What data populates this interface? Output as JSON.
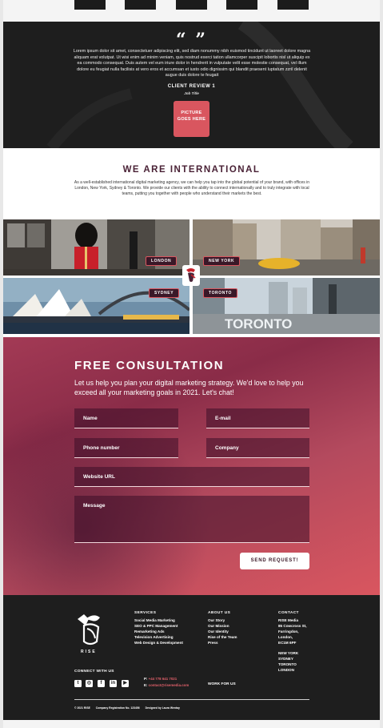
{
  "testimonial": {
    "quote_mark": "“ ”",
    "text": "Lorem ipsum dolor sit amet, consectetuer adipiscing elit, sed diam nonummy nibh euismod tincidunt ut laoreet dolore magna aliquam erat volutpat. Ut wisi enim ad minim veniam, quis nostrud exerci tation ullamcorper suscipit lobortis nisl ut aliquip ex ea commodo consequat. Duis autem vel eum iriure dolor in hendrerit in vulputate velit esse molestie consequat, vel illum dolore eu feugiat nulla facilisis at vero eros et accumsan et iusto odio dignissim qui blandit praesent luptatum zzril delenit augue duis dolore te feugait",
    "client_name": "CLIENT REVIEW 1",
    "client_title": "Job Title",
    "picture_button": "PICTURE GOES HERE"
  },
  "international": {
    "title": "WE ARE INTERNATIONAL",
    "text": "As a well-established international digital marketing agency, we can help you tap into the global potential of your brand, with offices in London, New York, Sydney & Toronto. We provide our clients with the ability to connect internationally and to truly integrate with local teams, putting you together with people who understand their markets the best."
  },
  "cities": [
    "LONDON",
    "NEW YORK",
    "SYDNEY",
    "TORONTO"
  ],
  "city_photo_text": {
    "toronto_sign": "TORONTO"
  },
  "consultation": {
    "title": "FREE CONSULTATION",
    "subtitle": "Let us help you plan your digital marketing strategy. We'd love to help you exceed all your marketing goals in 2021. Let's chat!",
    "fields": {
      "name": "Name",
      "email": "E-mail",
      "phone": "Phone number",
      "company": "Company",
      "website": "Website URL",
      "message": "Message"
    },
    "submit": "SEND REQUEST!"
  },
  "footer": {
    "brand": "RISE",
    "services": {
      "heading": "SERVICES",
      "items": [
        "Social Media Marketing",
        "SEO & PPC Management",
        "Remarketing Ads",
        "Television Advertising",
        "Web Design & Development"
      ]
    },
    "about": {
      "heading": "ABOUT US",
      "items": [
        "Our Story",
        "Our Mission",
        "Our Identity",
        "Rise of the Team",
        "Press"
      ]
    },
    "contact": {
      "heading": "CONTACT",
      "address": [
        "RISE Media",
        "85 Cowcross St,",
        "Farringdon,",
        "London,",
        "EC1M 6PF"
      ],
      "offices": [
        "NEW YORK",
        "SYDNEY",
        "TORONTO",
        "LONDON"
      ]
    },
    "connect_label": "CONNECT WITH US",
    "social_icons": [
      "twitter-icon",
      "instagram-icon",
      "facebook-icon",
      "linkedin-icon",
      "youtube-icon"
    ],
    "phone_label": "P:",
    "phone": "+44 778 641 7021",
    "email_label": "E:",
    "email": "contact@risemedia.com",
    "work_for_us": "WORK FOR US",
    "copyright": "© 2021 RISE",
    "company_reg": "Company Registration No. 123456",
    "designed_by": "Designed by Laura Wentay"
  },
  "colors": {
    "accent": "#d9565f",
    "dark": "#1e1e1e",
    "plum": "#4a2236"
  }
}
